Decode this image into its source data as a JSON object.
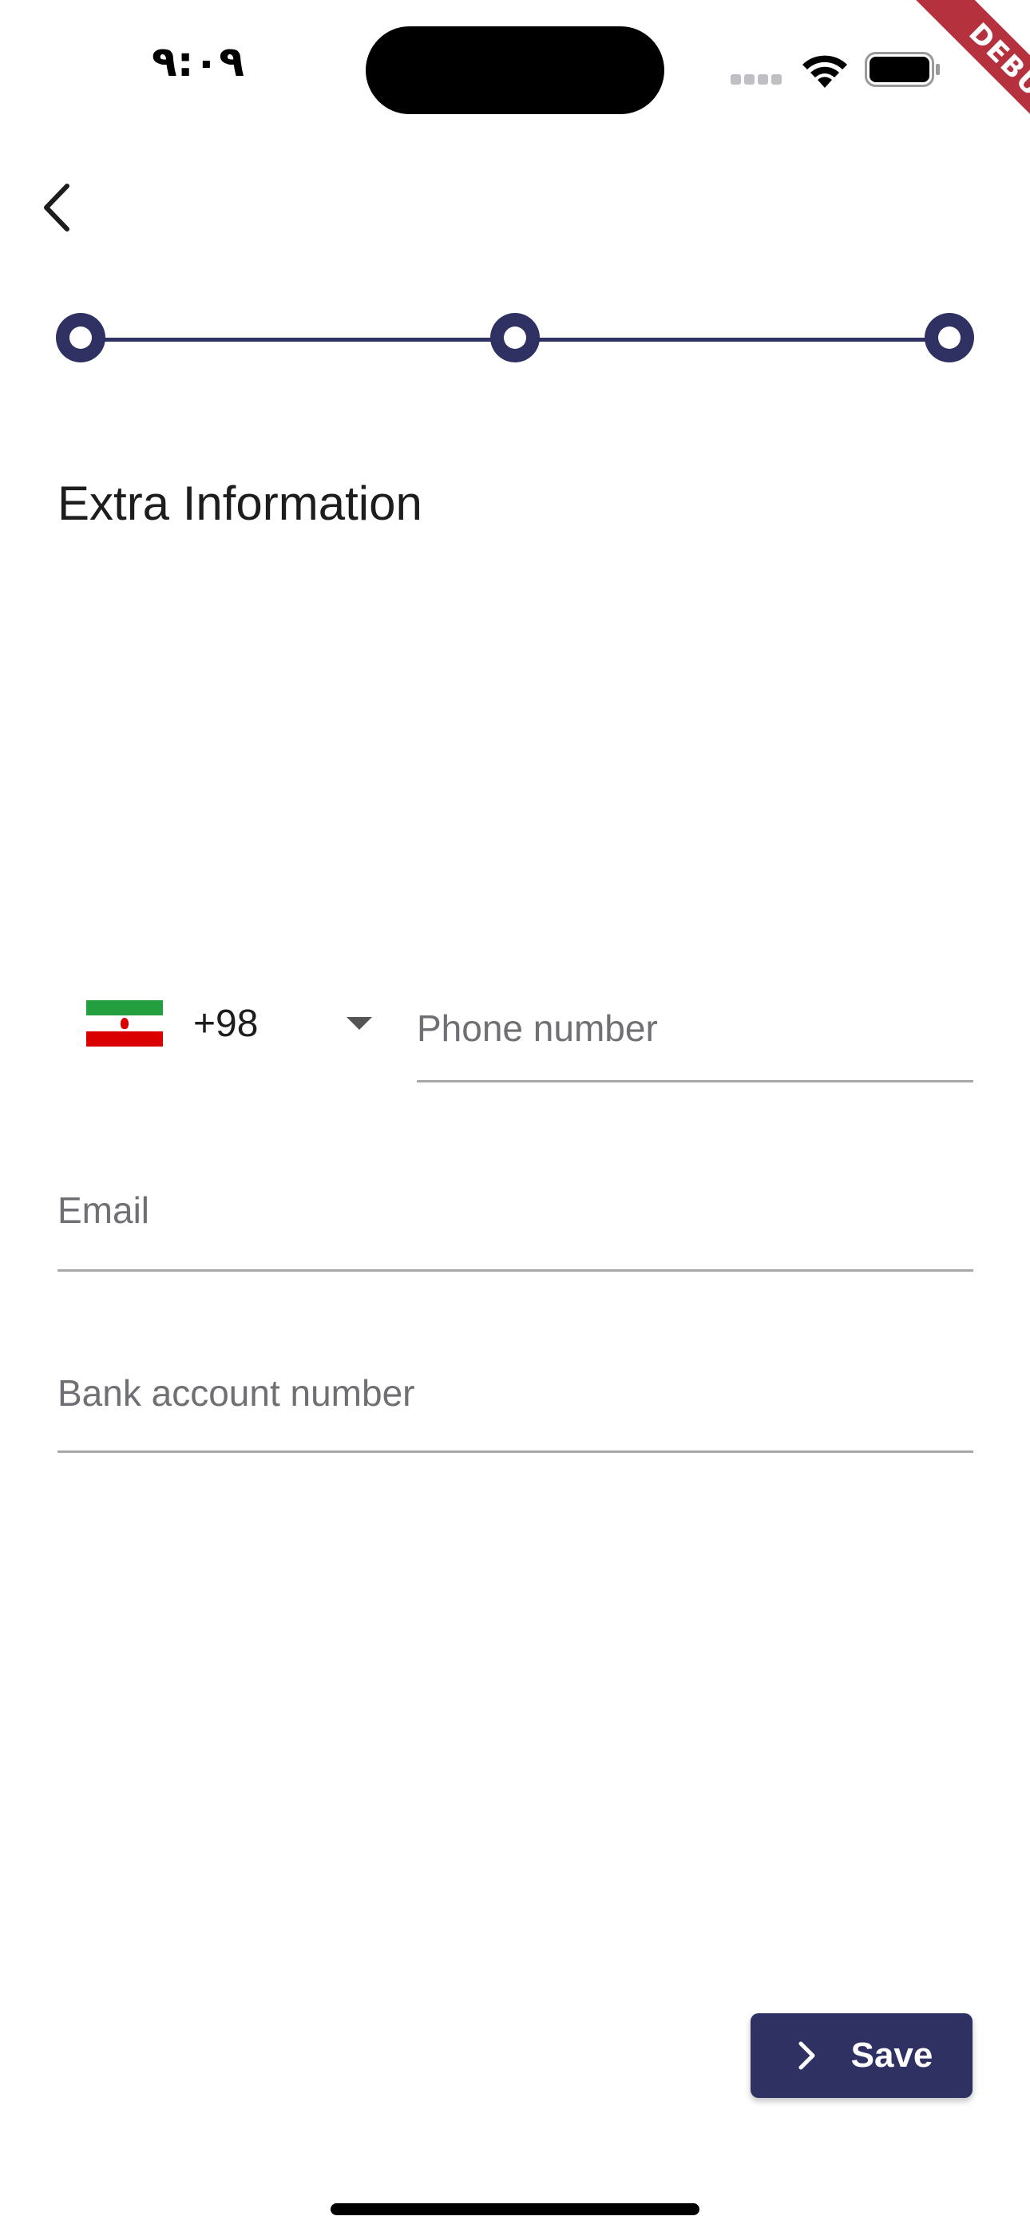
{
  "status_bar": {
    "time": "٩:٠٩"
  },
  "debug_banner": {
    "label": "DEBUG"
  },
  "navigation": {
    "back_icon": "chevron-left-icon"
  },
  "stepper": {
    "steps": 3,
    "accent_color": "#2f3163"
  },
  "page": {
    "title": "Extra Information"
  },
  "form": {
    "country": {
      "flag_icon": "iran-flag-icon",
      "dial_code": "+98"
    },
    "phone": {
      "value": "",
      "placeholder": "Phone number"
    },
    "email": {
      "value": "",
      "placeholder": "Email"
    },
    "bank_account": {
      "value": "",
      "placeholder": "Bank account number"
    }
  },
  "actions": {
    "save_label": "Save",
    "save_icon": "chevron-right-icon",
    "button_color": "#2f3163"
  }
}
